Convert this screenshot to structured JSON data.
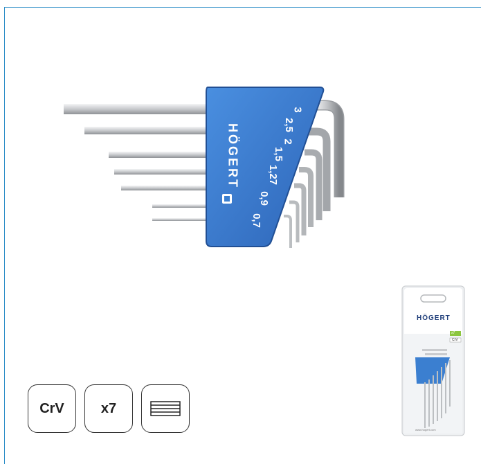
{
  "product": {
    "brand": "HÖGERT",
    "sizes": [
      "3",
      "2,5",
      "2",
      "1,5",
      "1,27",
      "0,9",
      "0,7"
    ]
  },
  "badges": {
    "material": "CrV",
    "count": "x7",
    "holder_icon": "holder-lines-icon"
  },
  "package": {
    "brand": "HÖGERT",
    "count_label": "x7",
    "material_label": "CrV",
    "website": "www.hogert.com"
  },
  "colors": {
    "frame": "#2f8fc8",
    "holder": "#3b7fd0",
    "holder_dark": "#2a63b0",
    "steel": "#c9cbce"
  }
}
